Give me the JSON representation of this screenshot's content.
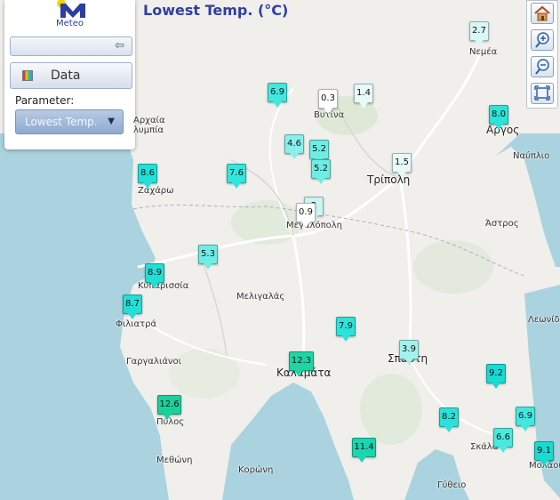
{
  "app": {
    "logo_text": "Meteo",
    "brand_color": "#2b3ea0"
  },
  "map_title": "Lowest Temp. (°C)",
  "panel": {
    "collapse_icon": "arrow-left-icon",
    "data_label": "Data",
    "data_icon": "chart-icon",
    "parameter_label": "Parameter:",
    "parameter_value": "Lowest Temp."
  },
  "tools": [
    {
      "name": "home-button",
      "icon": "home-icon"
    },
    {
      "name": "zoom-in-button",
      "icon": "zoom-in-icon"
    },
    {
      "name": "zoom-out-button",
      "icon": "zoom-out-icon"
    },
    {
      "name": "fullscreen-button",
      "icon": "fullscreen-icon"
    }
  ],
  "stations": [
    {
      "value": "2.7",
      "color": "#d9f7f5"
    },
    {
      "value": "8.0",
      "color": "#2de3d9"
    },
    {
      "value": "6.9",
      "color": "#42e8de"
    },
    {
      "value": "0.3",
      "color": "#ffffff"
    },
    {
      "value": "1.4",
      "color": "#e6faf8"
    },
    {
      "value": "4.6",
      "color": "#88f0ea"
    },
    {
      "value": "5.2",
      "color": "#6eedE5"
    },
    {
      "value": "5.2",
      "color": "#6eede5"
    },
    {
      "value": "1.5",
      "color": "#e6faf8"
    },
    {
      "value": "8.6",
      "color": "#22e0d8"
    },
    {
      "value": "7.6",
      "color": "#33e5dc"
    },
    {
      "value": "2",
      "color": "#c8f5f2"
    },
    {
      "value": "0.9",
      "color": "#ffffff"
    },
    {
      "value": "5.3",
      "color": "#6eede5"
    },
    {
      "value": "8.9",
      "color": "#1fdfd6"
    },
    {
      "value": "8.7",
      "color": "#22e0d8"
    },
    {
      "value": "7.9",
      "color": "#2de3d9"
    },
    {
      "value": "3.9",
      "color": "#a3f2ed"
    },
    {
      "value": "12.3",
      "color": "#1cd6a6"
    },
    {
      "value": "9.2",
      "color": "#1adbd2"
    },
    {
      "value": "12.6",
      "color": "#1ad19e"
    },
    {
      "value": "8.2",
      "color": "#2ae2d9"
    },
    {
      "value": "6.9",
      "color": "#42e8de"
    },
    {
      "value": "6.6",
      "color": "#4ae9df"
    },
    {
      "value": "11.4",
      "color": "#1cd4b0"
    },
    {
      "value": "9.1",
      "color": "#1adbd2"
    }
  ],
  "towns": [
    "Νεμέα",
    "Αργος",
    "Ναύπλιο",
    "Αρχαία",
    "λυμπία",
    "Βυτίνα",
    "Ζαχάρω",
    "Τρίπολη",
    "Μεγαλόπολη",
    "Άστρος",
    "Κυπαρισσία",
    "Μελιγαλάς",
    "Φιλιατρά",
    "Λεωνίδι",
    "Γαργαλιάνοι",
    "Σπάρτη",
    "Καλαμάτα",
    "Πύλος",
    "Σκάλα",
    "Μεθώνη",
    "Κορώνη",
    "Μολάοι",
    "Γύθειο"
  ]
}
